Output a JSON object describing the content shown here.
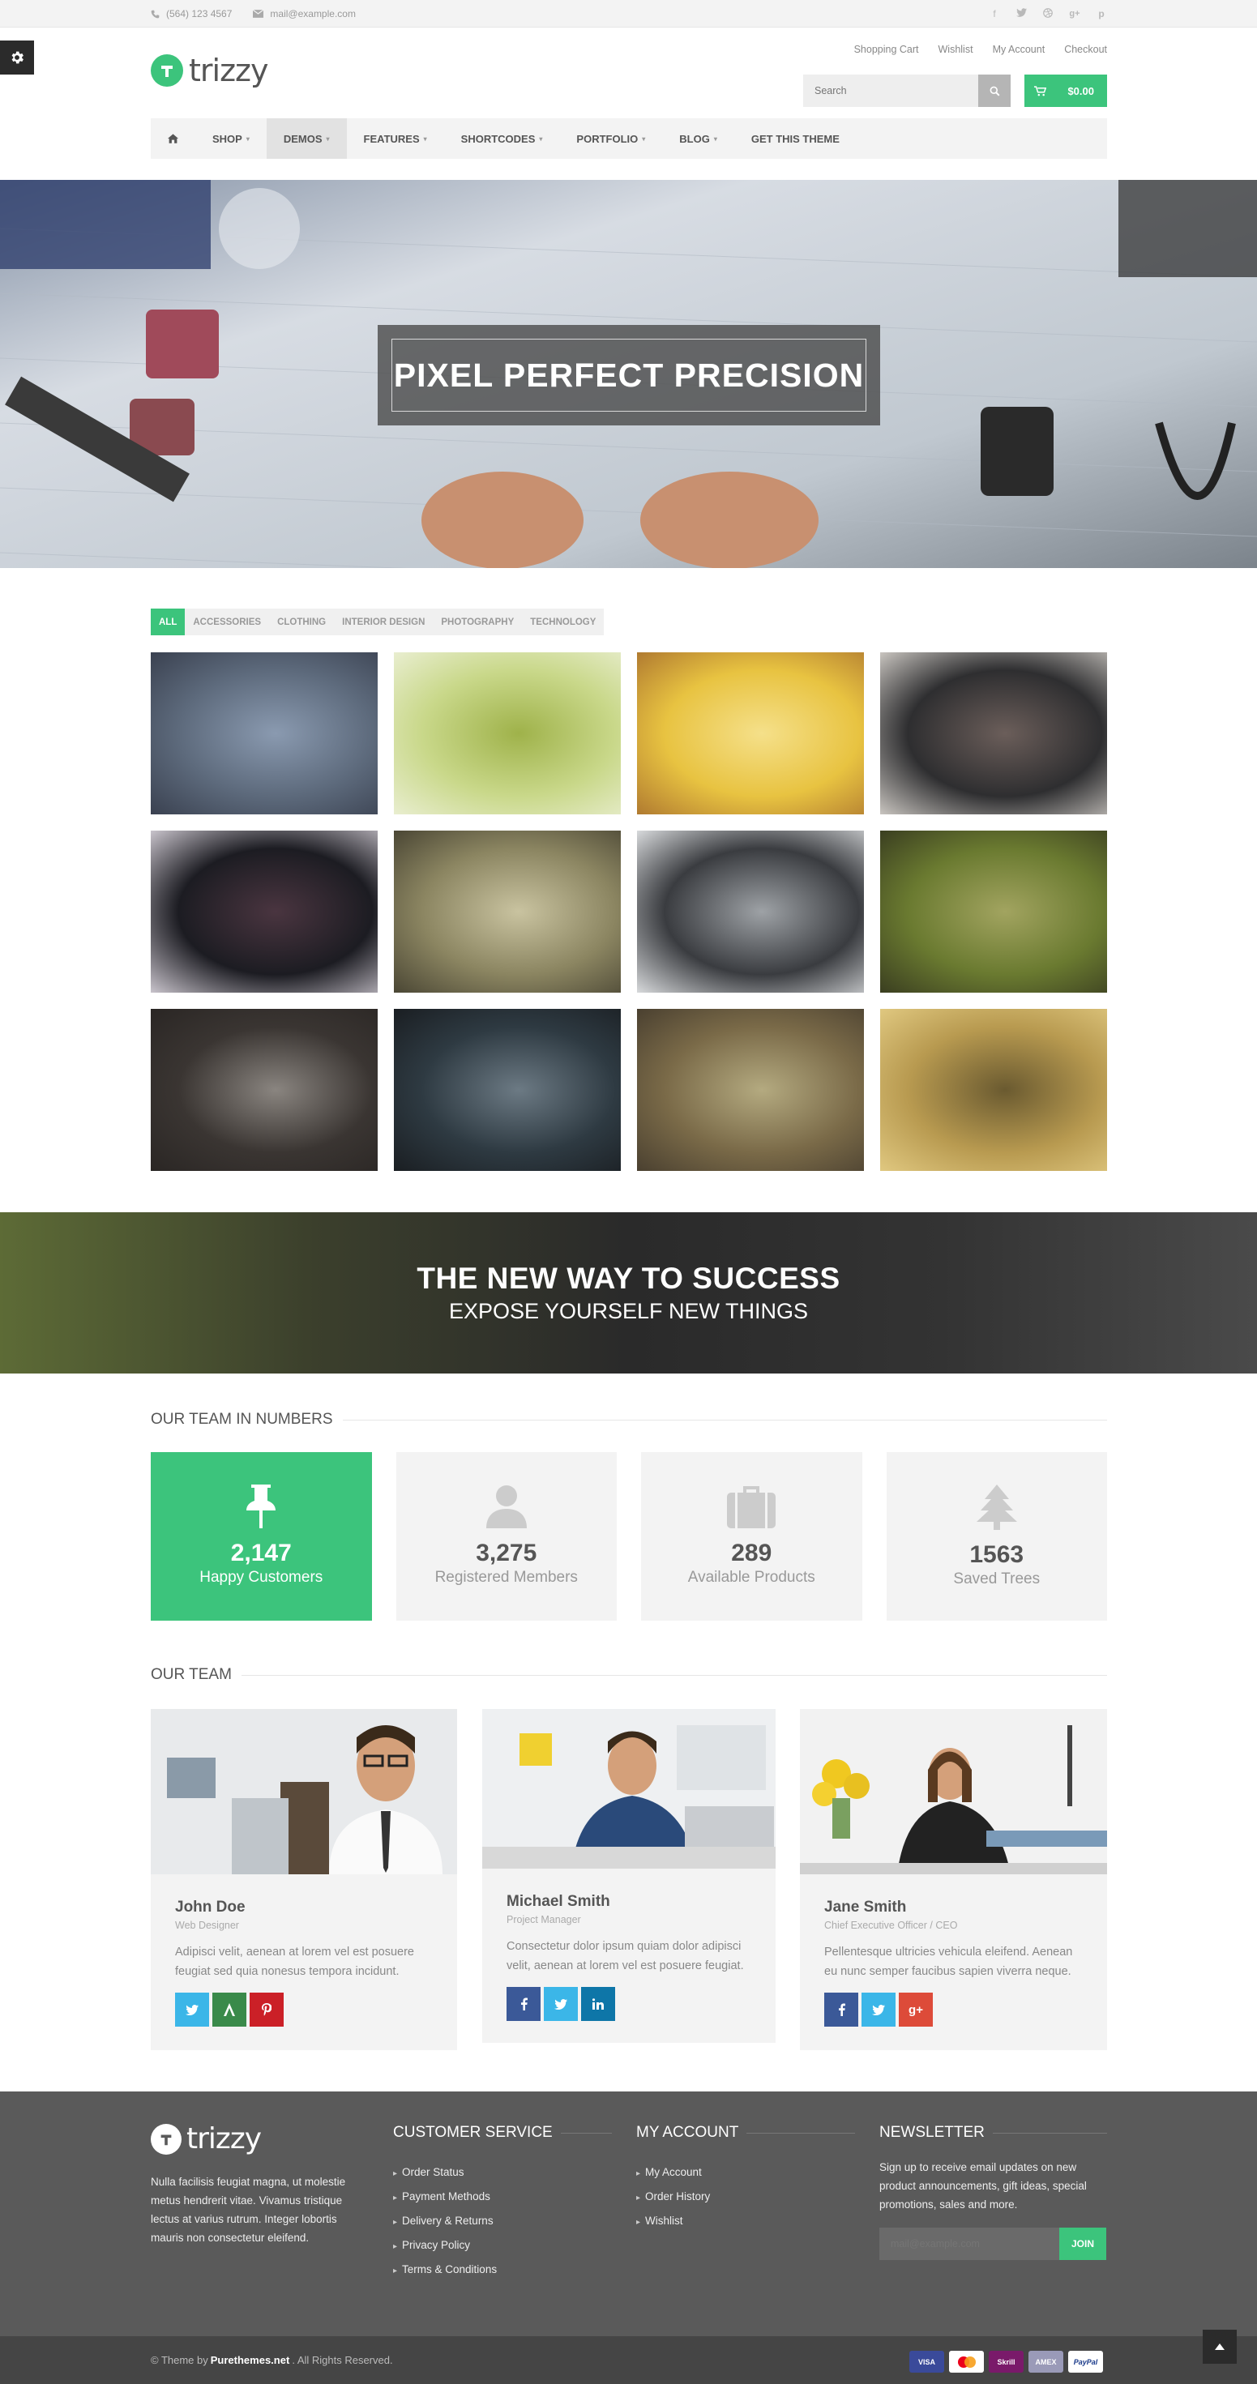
{
  "topbar": {
    "phone": "(564) 123 4567",
    "email": "mail@example.com",
    "social_icons": [
      "facebook-icon",
      "twitter-icon",
      "dribbble-icon",
      "google-plus-icon",
      "pinterest-icon"
    ]
  },
  "header": {
    "logo_text": "trizzy",
    "user_nav": [
      "Shopping Cart",
      "Wishlist",
      "My Account",
      "Checkout"
    ],
    "search_placeholder": "Search",
    "cart_total": "$0.00"
  },
  "nav": {
    "items": [
      {
        "label": "Shop",
        "dropdown": true
      },
      {
        "label": "Demos",
        "dropdown": true,
        "active": true
      },
      {
        "label": "Features",
        "dropdown": true
      },
      {
        "label": "Shortcodes",
        "dropdown": true
      },
      {
        "label": "Portfolio",
        "dropdown": true
      },
      {
        "label": "Blog",
        "dropdown": true
      },
      {
        "label": "Get This Theme",
        "dropdown": false
      }
    ]
  },
  "hero": {
    "title": "PIXEL PERFECT PRECISION"
  },
  "portfolio": {
    "filters": [
      "All",
      "Accessories",
      "Clothing",
      "Interior Design",
      "Photography",
      "Technology"
    ],
    "active_filter": "All",
    "tiles": [
      {
        "name": "jacket-photo",
        "colors": [
          "#5d6a7c",
          "#8a9ab0",
          "#3a4150"
        ]
      },
      {
        "name": "leaf-photo",
        "colors": [
          "#c9d88a",
          "#9fb24a",
          "#e9eed0"
        ]
      },
      {
        "name": "raspberries-photo",
        "colors": [
          "#e8c341",
          "#f5e08a",
          "#b07a30"
        ]
      },
      {
        "name": "laptop-photo",
        "colors": [
          "#2e2e30",
          "#6b5e5a",
          "#c9c5c0"
        ]
      },
      {
        "name": "speedometer-photo",
        "colors": [
          "#1c1c22",
          "#4a3540",
          "#c9c4cc"
        ]
      },
      {
        "name": "airplane-photo",
        "colors": [
          "#8b8561",
          "#c9c3a0",
          "#4a4634"
        ]
      },
      {
        "name": "building-photo",
        "colors": [
          "#3a3c40",
          "#9ea2a6",
          "#d8dadc"
        ]
      },
      {
        "name": "pinecone-photo",
        "colors": [
          "#6a7a30",
          "#a2a460",
          "#3a3e20"
        ]
      },
      {
        "name": "desk-photo",
        "colors": [
          "#3a3532",
          "#8a8580",
          "#2a2624"
        ]
      },
      {
        "name": "watch-photo",
        "colors": [
          "#2e3a42",
          "#6c7a84",
          "#1a1e22"
        ]
      },
      {
        "name": "hiker-photo",
        "colors": [
          "#7a6a48",
          "#b4aa80",
          "#4a4030"
        ]
      },
      {
        "name": "dog-photo",
        "colors": [
          "#b89a50",
          "#6a5a30",
          "#e0c880"
        ]
      }
    ]
  },
  "cta": {
    "title": "THE NEW WAY TO SUCCESS",
    "subtitle": "EXPOSE YOURSELF NEW THINGS"
  },
  "numbers": {
    "title": "Our Team in Numbers",
    "stats": [
      {
        "icon": "pushpin-icon",
        "value": "2,147",
        "label": "Happy Customers",
        "highlight": true
      },
      {
        "icon": "user-icon",
        "value": "3,275",
        "label": "Registered Members",
        "highlight": false
      },
      {
        "icon": "briefcase-icon",
        "value": "289",
        "label": "Available Products",
        "highlight": false
      },
      {
        "icon": "tree-icon",
        "value": "1563",
        "label": "Saved Trees",
        "highlight": false
      }
    ]
  },
  "team": {
    "title": "Our Team",
    "members": [
      {
        "name": "John Doe",
        "role": "Web Designer",
        "bio": "Adipisci velit, aenean at lorem vel est posuere feugiat sed quia nonesus tempora incidunt.",
        "social": [
          "twitter",
          "vine",
          "pinterest"
        ]
      },
      {
        "name": "Michael Smith",
        "role": "Project Manager",
        "bio": "Consectetur dolor ipsum quiam dolor adipisci velit, aenean at lorem vel est posuere feugiat.",
        "social": [
          "facebook",
          "twitter",
          "linkedin"
        ]
      },
      {
        "name": "Jane Smith",
        "role": "Chief Executive Officer / CEO",
        "bio": "Pellentesque ultricies vehicula eleifend. Aenean eu nunc semper faucibus sapien viverra neque.",
        "social": [
          "facebook",
          "twitter",
          "google-plus"
        ]
      }
    ]
  },
  "footer": {
    "logo_text": "trizzy",
    "about": "Nulla facilisis feugiat magna, ut molestie metus hendrerit vitae. Vivamus tristique lectus at varius rutrum. Integer lobortis mauris non consectetur eleifend.",
    "customer_service": {
      "title": "Customer Service",
      "links": [
        "Order Status",
        "Payment Methods",
        "Delivery & Returns",
        "Privacy Policy",
        "Terms & Conditions"
      ]
    },
    "my_account": {
      "title": "My Account",
      "links": [
        "My Account",
        "Order History",
        "Wishlist"
      ]
    },
    "newsletter": {
      "title": "Newsletter",
      "text": "Sign up to receive email updates on new product announcements, gift ideas, special promotions, sales and more.",
      "placeholder": "mail@example.com",
      "button": "JOIN"
    }
  },
  "bottombar": {
    "copy_prefix": "© Theme by",
    "brand": "Purethemes.net",
    "copy_suffix": ". All Rights Reserved.",
    "payments": [
      "VISA",
      "MC",
      "Skrill",
      "AMEX",
      "PayPal"
    ]
  },
  "colors": {
    "accent": "#3cc47c",
    "footer": "#5a5a5a",
    "bottombar": "#454545"
  }
}
